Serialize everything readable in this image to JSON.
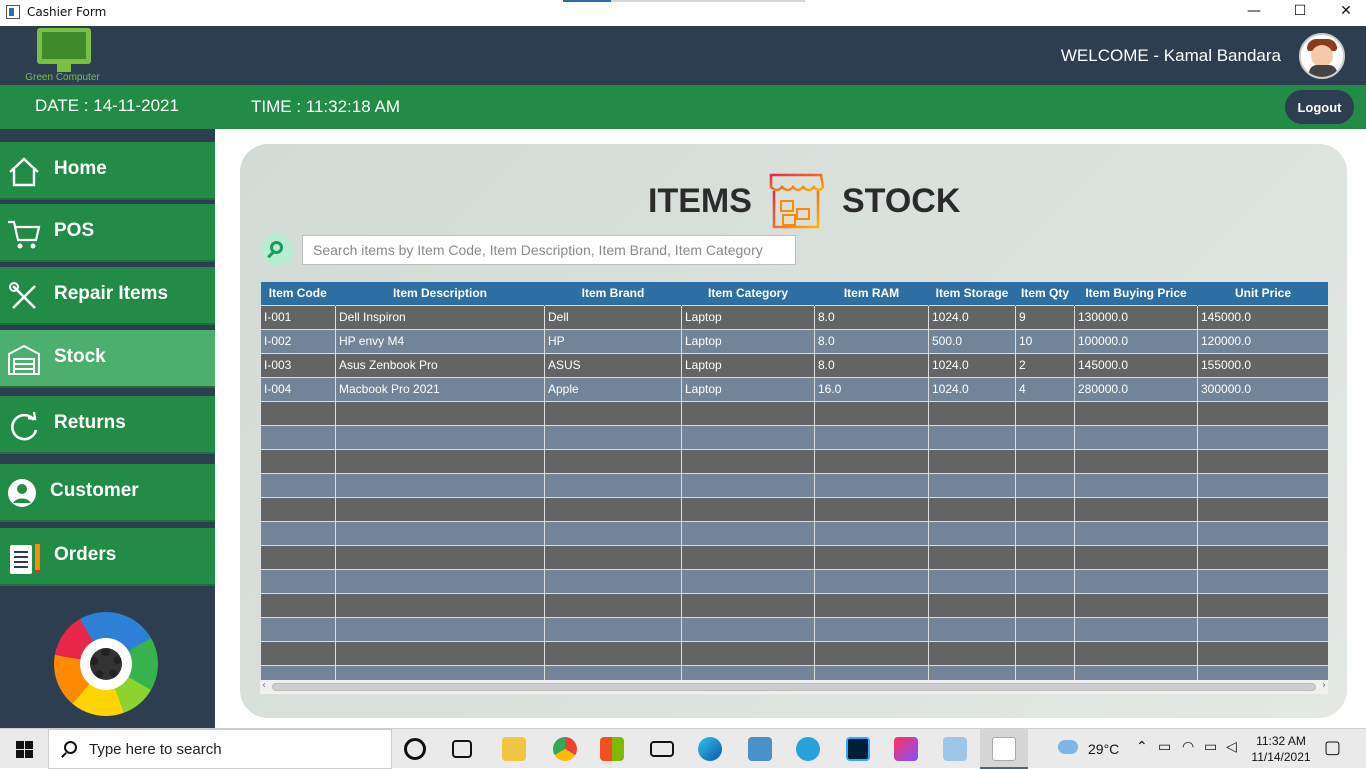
{
  "window": {
    "title": "Cashier Form",
    "minimize": "—",
    "maximize": "☐",
    "close": "✕"
  },
  "header": {
    "logo_text": "Green Computer",
    "welcome": "WELCOME - Kamal Bandara"
  },
  "infobar": {
    "date": "DATE : 14-11-2021",
    "time": "TIME : 11:32:18 AM",
    "logout": "Logout"
  },
  "sidebar": {
    "items": [
      {
        "label": "Home",
        "icon": "home-icon"
      },
      {
        "label": "POS",
        "icon": "cart-icon"
      },
      {
        "label": "Repair Items",
        "icon": "tools-icon"
      },
      {
        "label": "Stock",
        "icon": "store-icon",
        "active": true
      },
      {
        "label": "Returns",
        "icon": "refresh-icon"
      },
      {
        "label": "Customer",
        "icon": "user-icon"
      },
      {
        "label": "Orders",
        "icon": "clipboard-icon"
      }
    ]
  },
  "main": {
    "heading_left": "ITEMS",
    "heading_right": "STOCK",
    "search_placeholder": "Search items by Item Code, Item Description, Item Brand, Item Category",
    "table": {
      "columns": [
        "Item Code",
        "Item Description",
        "Item Brand",
        "Item Category",
        "Item RAM",
        "Item Storage",
        "Item Qty",
        "Item Buying Price",
        "Unit Price"
      ],
      "rows": [
        [
          "I-001",
          "Dell Inspiron",
          "Dell",
          "Laptop",
          "8.0",
          "1024.0",
          "9",
          "130000.0",
          "145000.0"
        ],
        [
          "I-002",
          "HP envy M4",
          "HP",
          "Laptop",
          "8.0",
          "500.0",
          "10",
          "100000.0",
          "120000.0"
        ],
        [
          "I-003",
          "Asus Zenbook Pro",
          "ASUS",
          "Laptop",
          "8.0",
          "1024.0",
          "2",
          "145000.0",
          "155000.0"
        ],
        [
          "I-004",
          "Macbook Pro 2021",
          "Apple",
          "Laptop",
          "16.0",
          "1024.0",
          "4",
          "280000.0",
          "300000.0"
        ]
      ],
      "empty_rows": 12
    }
  },
  "taskbar": {
    "search_placeholder": "Type here to search",
    "temperature": "29°C",
    "time": "11:32 AM",
    "date": "11/14/2021"
  }
}
